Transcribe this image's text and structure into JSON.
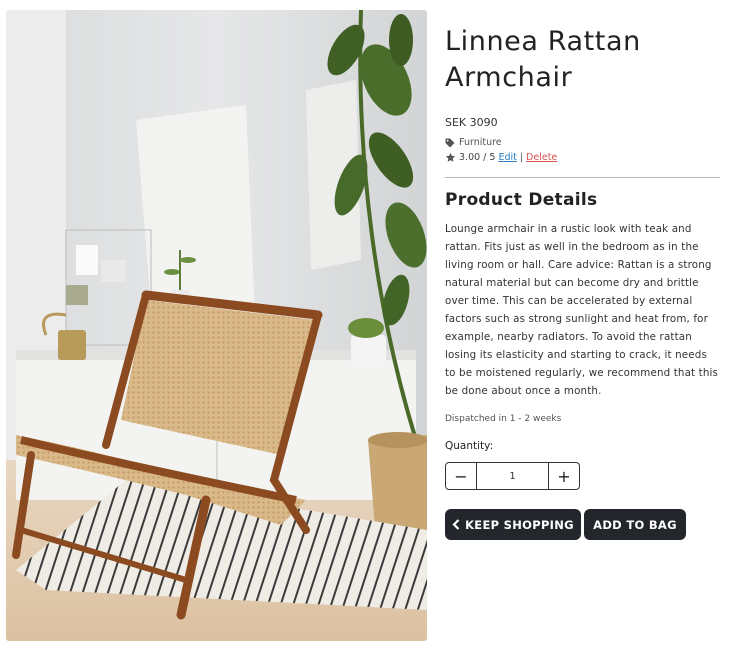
{
  "product": {
    "name": "Linnea Rattan Armchair",
    "price": "SEK 3090",
    "category": "Furniture",
    "category_icon": "tag-icon",
    "rating": "3.00 / 5",
    "rating_icon": "star-icon",
    "edit_label": "Edit",
    "separator": "|",
    "delete_label": "Delete",
    "image_alt": "Rattan armchair with teak frame in a sunlit room"
  },
  "details": {
    "title": "Product Details",
    "description": "Lounge armchair in a rustic look with teak and rattan. Fits just as well in the bedroom as in the living room or hall. Care advice: Rattan is a strong natural material but can become dry and brittle over time. This can be accelerated by external factors such as strong sunlight and heat from, for example, nearby radiators. To avoid the rattan losing its elasticity and starting to crack, it needs to be moistened regularly, we recommend that this be done about once a month.",
    "dispatch": "Dispatched in 1 - 2 weeks"
  },
  "quantity": {
    "label": "Quantity:",
    "value": "1",
    "decrement": "−",
    "increment": "+"
  },
  "actions": {
    "keep_shopping": "KEEP SHOPPING",
    "keep_shopping_icon": "chevron-left-icon",
    "add_to_bag": "ADD TO BAG"
  },
  "colors": {
    "button_bg": "#23272b",
    "edit_link": "#2f80c9",
    "delete_link": "#d9534f"
  }
}
